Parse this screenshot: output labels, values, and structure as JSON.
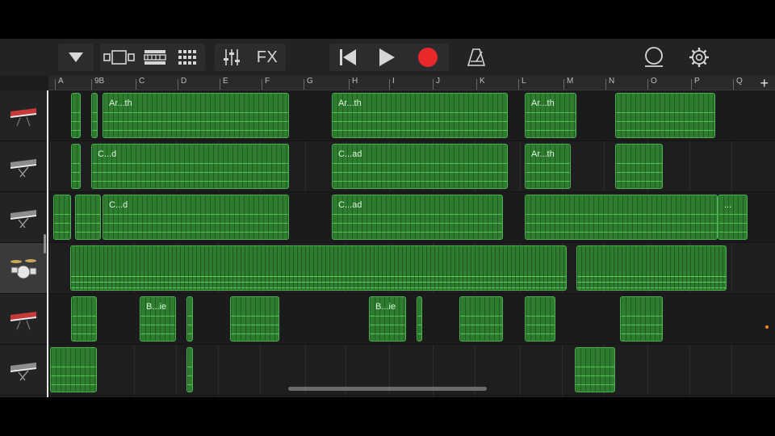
{
  "toolbar": {
    "fx_label": "FX",
    "accent_record": "#e8282b",
    "icons": [
      "dropdown-icon",
      "view-toggle-icon",
      "tracks-view-icon",
      "grid-icon",
      "mixer-icon",
      "fx-icon",
      "rewind-icon",
      "play-icon",
      "record-icon",
      "metronome-icon",
      "loop-icon",
      "settings-icon"
    ]
  },
  "ruler": {
    "markers": [
      "A",
      "9B",
      "C",
      "D",
      "E",
      "F",
      "G",
      "H",
      "I",
      "J",
      "K",
      "L",
      "M",
      "N",
      "O",
      "P",
      "Q"
    ],
    "add_label": "+"
  },
  "tracks": [
    {
      "instrument": "keyboard-red",
      "regions": [
        {
          "label": ""
        },
        {
          "label": ""
        },
        {
          "label": "Ar...th"
        },
        {
          "label": "Ar...th"
        },
        {
          "label": "Ar...th"
        },
        {
          "label": ""
        }
      ]
    },
    {
      "instrument": "keyboard-stand",
      "regions": [
        {
          "label": ""
        },
        {
          "label": "C...d"
        },
        {
          "label": "C...ad"
        },
        {
          "label": "Ar...th"
        },
        {
          "label": ""
        }
      ]
    },
    {
      "instrument": "keyboard-stand",
      "regions": [
        {
          "label": ""
        },
        {
          "label": ""
        },
        {
          "label": "C...d"
        },
        {
          "label": "C...ad"
        },
        {
          "label": ""
        },
        {
          "label": "..."
        }
      ]
    },
    {
      "instrument": "drums",
      "regions": [
        {
          "label": ""
        },
        {
          "label": ""
        }
      ]
    },
    {
      "instrument": "keyboard-red",
      "regions": [
        {
          "label": ""
        },
        {
          "label": "B...ie"
        },
        {
          "label": ""
        },
        {
          "label": ""
        },
        {
          "label": "B...ie"
        },
        {
          "label": ""
        },
        {
          "label": ""
        },
        {
          "label": ""
        },
        {
          "label": ""
        }
      ]
    },
    {
      "instrument": "keyboard-stand",
      "regions": [
        {
          "label": ""
        },
        {
          "label": ""
        },
        {
          "label": ""
        }
      ]
    }
  ],
  "colors": {
    "region_fill": "#2e7d2f",
    "region_border": "#4caf50",
    "note": "#78ff78",
    "playhead": "#e6e6e6"
  }
}
